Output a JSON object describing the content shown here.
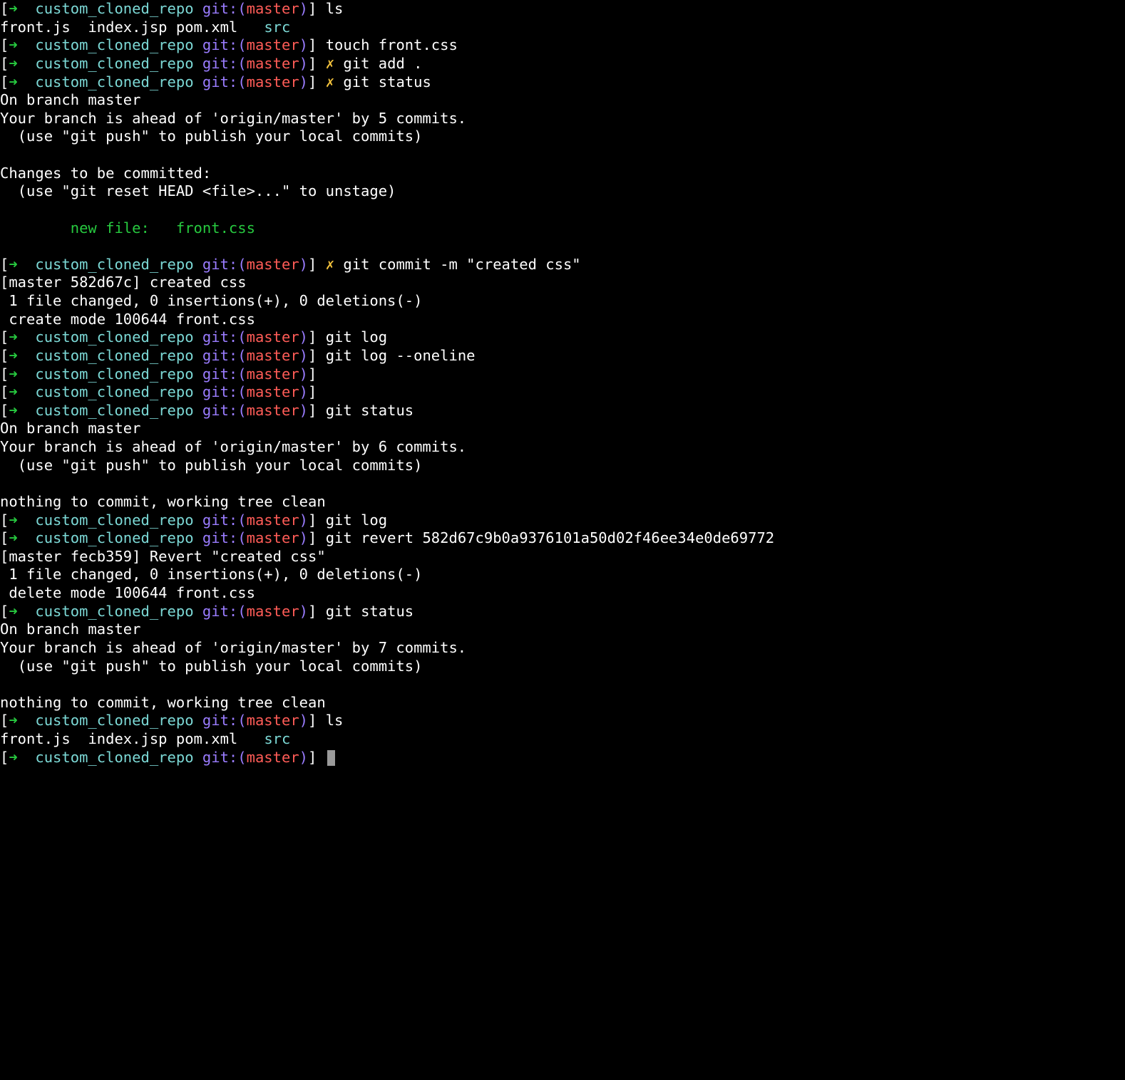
{
  "colors": {
    "green": "#27c93f",
    "cyan": "#7cd9d6",
    "blue": "#9a7cff",
    "red": "#ff5c57",
    "yellow": "#f3c23c",
    "white": "#ffffff"
  },
  "prompt": {
    "arrow": "➜",
    "bracket_open": "[",
    "bracket_close": "]",
    "dir": "custom_cloned_repo",
    "vcs": "git:",
    "paren_open": "(",
    "paren_close": ")",
    "branch": "master",
    "dirty": "✗"
  },
  "lines": [
    {
      "type": "prompt",
      "dirty": false,
      "cmd": "ls"
    },
    {
      "type": "ls",
      "files": [
        "front.js",
        "index.jsp",
        "pom.xml",
        "src"
      ],
      "src_color": "cyan"
    },
    {
      "type": "prompt",
      "dirty": false,
      "cmd": "touch front.css"
    },
    {
      "type": "prompt",
      "dirty": true,
      "cmd": "git add ."
    },
    {
      "type": "prompt",
      "dirty": true,
      "cmd": "git status"
    },
    {
      "type": "plain",
      "text": "On branch master"
    },
    {
      "type": "plain",
      "text": "Your branch is ahead of 'origin/master' by 5 commits."
    },
    {
      "type": "plain",
      "text": "  (use \"git push\" to publish your local commits)"
    },
    {
      "type": "plain",
      "text": ""
    },
    {
      "type": "plain",
      "text": "Changes to be committed:"
    },
    {
      "type": "plain",
      "text": "  (use \"git reset HEAD <file>...\" to unstage)"
    },
    {
      "type": "plain",
      "text": ""
    },
    {
      "type": "newfile",
      "text": "        new file:   front.css"
    },
    {
      "type": "plain",
      "text": ""
    },
    {
      "type": "prompt",
      "dirty": true,
      "cmd": "git commit -m \"created css\""
    },
    {
      "type": "plain",
      "text": "[master 582d67c] created css"
    },
    {
      "type": "plain",
      "text": " 1 file changed, 0 insertions(+), 0 deletions(-)"
    },
    {
      "type": "plain",
      "text": " create mode 100644 front.css"
    },
    {
      "type": "prompt",
      "dirty": false,
      "cmd": "git log"
    },
    {
      "type": "prompt",
      "dirty": false,
      "cmd": "git log --oneline"
    },
    {
      "type": "prompt",
      "dirty": false,
      "cmd": ""
    },
    {
      "type": "prompt",
      "dirty": false,
      "cmd": ""
    },
    {
      "type": "prompt",
      "dirty": false,
      "cmd": "git status"
    },
    {
      "type": "plain",
      "text": "On branch master"
    },
    {
      "type": "plain",
      "text": "Your branch is ahead of 'origin/master' by 6 commits."
    },
    {
      "type": "plain",
      "text": "  (use \"git push\" to publish your local commits)"
    },
    {
      "type": "plain",
      "text": ""
    },
    {
      "type": "plain",
      "text": "nothing to commit, working tree clean"
    },
    {
      "type": "prompt",
      "dirty": false,
      "cmd": "git log"
    },
    {
      "type": "prompt",
      "dirty": false,
      "cmd": "git revert 582d67c9b0a9376101a50d02f46ee34e0de69772"
    },
    {
      "type": "plain",
      "text": "[master fecb359] Revert \"created css\""
    },
    {
      "type": "plain",
      "text": " 1 file changed, 0 insertions(+), 0 deletions(-)"
    },
    {
      "type": "plain",
      "text": " delete mode 100644 front.css"
    },
    {
      "type": "prompt",
      "dirty": false,
      "cmd": "git status"
    },
    {
      "type": "plain",
      "text": "On branch master"
    },
    {
      "type": "plain",
      "text": "Your branch is ahead of 'origin/master' by 7 commits."
    },
    {
      "type": "plain",
      "text": "  (use \"git push\" to publish your local commits)"
    },
    {
      "type": "plain",
      "text": ""
    },
    {
      "type": "plain",
      "text": "nothing to commit, working tree clean"
    },
    {
      "type": "prompt",
      "dirty": false,
      "cmd": "ls"
    },
    {
      "type": "ls",
      "files": [
        "front.js",
        "index.jsp",
        "pom.xml",
        "src"
      ],
      "src_color": "cyan"
    },
    {
      "type": "prompt_cursor",
      "dirty": false
    }
  ]
}
